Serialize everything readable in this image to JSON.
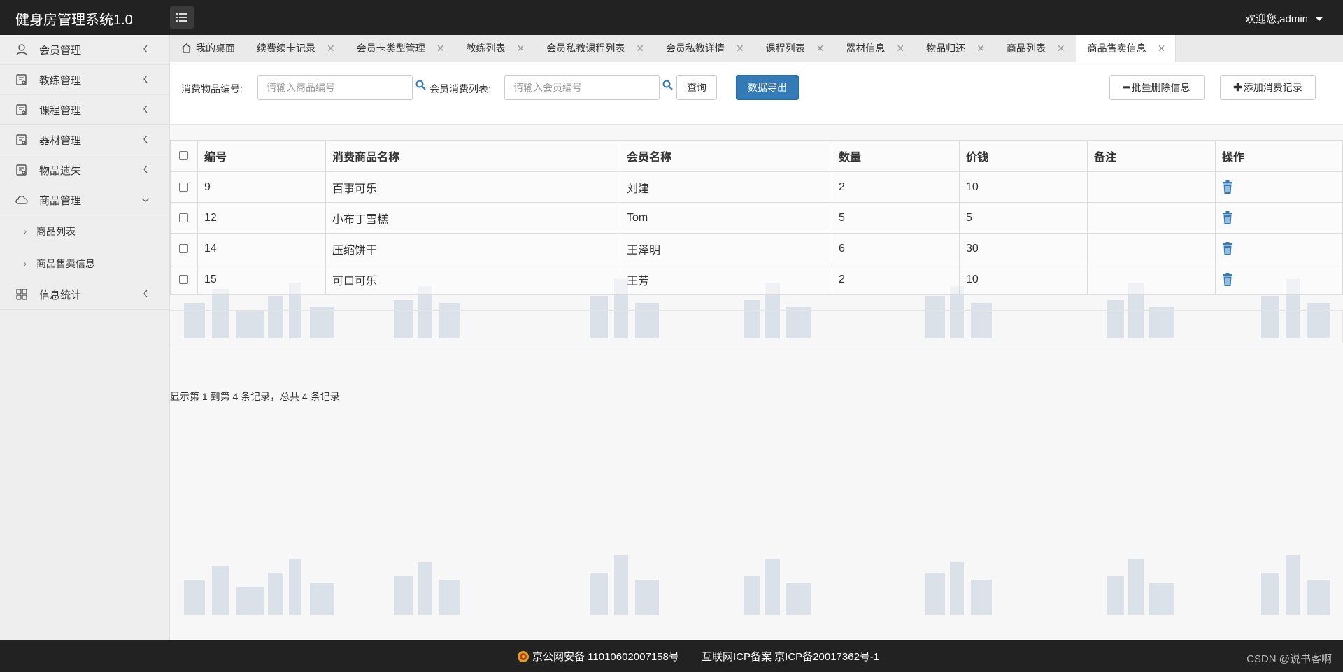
{
  "app": {
    "title": "健身房管理系统1.0",
    "welcome": "欢迎您,admin"
  },
  "sidebar": {
    "items": [
      {
        "label": "会员管理",
        "icon": "user-icon"
      },
      {
        "label": "教练管理",
        "icon": "document-icon"
      },
      {
        "label": "课程管理",
        "icon": "document-icon"
      },
      {
        "label": "器材管理",
        "icon": "document-icon"
      },
      {
        "label": "物品遗失",
        "icon": "document-icon"
      },
      {
        "label": "商品管理",
        "icon": "cloud-icon",
        "expanded": true
      },
      {
        "label": "信息统计",
        "icon": "grid-icon"
      }
    ],
    "subitems": [
      "商品列表",
      "商品售卖信息"
    ]
  },
  "tabs": [
    {
      "label": "我的桌面"
    },
    {
      "label": "续费续卡记录"
    },
    {
      "label": "会员卡类型管理"
    },
    {
      "label": "教练列表"
    },
    {
      "label": "会员私教课程列表"
    },
    {
      "label": "会员私教详情"
    },
    {
      "label": "课程列表"
    },
    {
      "label": "器材信息"
    },
    {
      "label": "物品归还"
    },
    {
      "label": "商品列表"
    },
    {
      "label": "商品售卖信息",
      "active": true
    }
  ],
  "toolbar": {
    "product_label": "消费物品编号:",
    "product_placeholder": "请输入商品编号",
    "member_label": "会员消费列表:",
    "member_placeholder": "请输入会员编号",
    "query": "查询",
    "export": "数据导出",
    "batch_delete": "批量删除信息",
    "add_record": "添加消费记录"
  },
  "table": {
    "headers": [
      "编号",
      "消费商品名称",
      "会员名称",
      "数量",
      "价钱",
      "备注",
      "操作"
    ],
    "rows": [
      [
        "9",
        "百事可乐",
        "刘建",
        "2",
        "10",
        ""
      ],
      [
        "12",
        "小布丁雪糕",
        "Tom",
        "5",
        "5",
        ""
      ],
      [
        "14",
        "压缩饼干",
        "王泽明",
        "6",
        "30",
        ""
      ],
      [
        "15",
        "可口可乐",
        "王芳",
        "2",
        "10",
        ""
      ]
    ]
  },
  "pager": {
    "info": "显示第 1 到第 4 条记录，总共 4 条记录"
  },
  "footer": {
    "police": "京公网安备 11010602007158号",
    "icp": "互联网ICP备案 京ICP备20017362号-1",
    "credit": "CSDN @说书客啊"
  },
  "colors": {
    "topbar": "#222222",
    "primary": "#337ab7",
    "sidebar": "#eeeeee"
  }
}
